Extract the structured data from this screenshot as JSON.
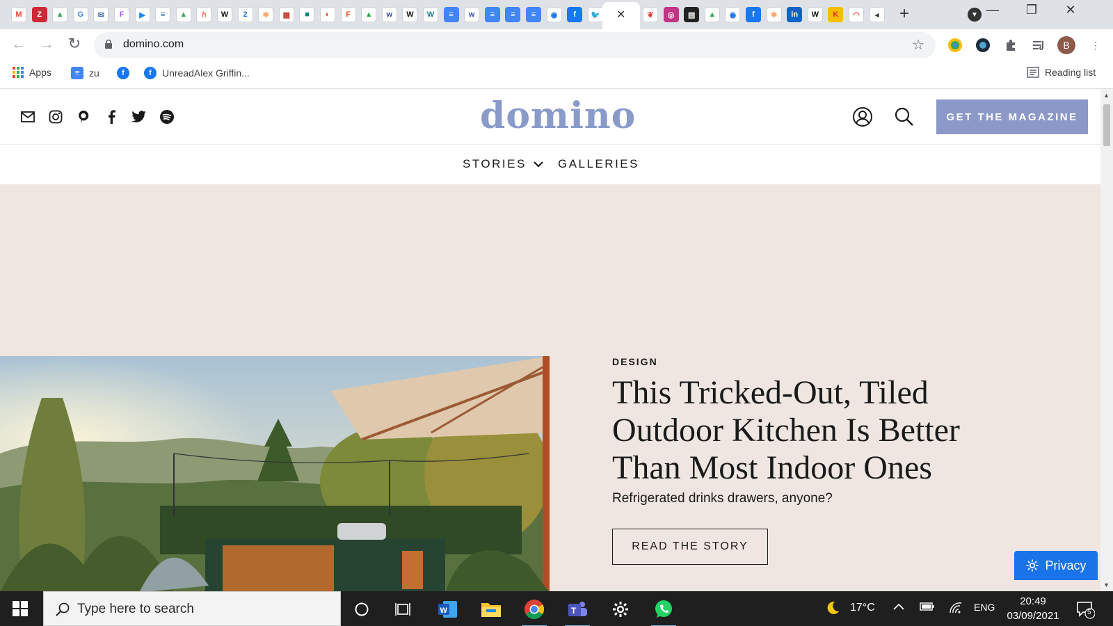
{
  "browser": {
    "tab_favicons": [
      {
        "name": "gmail",
        "bg": "#ffffff",
        "fg": "#ea4335",
        "glyph": "M"
      },
      {
        "name": "zotero",
        "bg": "#cc2936",
        "fg": "#ffffff",
        "glyph": "Z"
      },
      {
        "name": "drive",
        "bg": "#ffffff",
        "fg": "#34a853",
        "glyph": "▲"
      },
      {
        "name": "google",
        "bg": "#ffffff",
        "fg": "#4285f4",
        "glyph": "G"
      },
      {
        "name": "mail",
        "bg": "#ffffff",
        "fg": "#4a6fa5",
        "glyph": "✉"
      },
      {
        "name": "figma",
        "bg": "#ffffff",
        "fg": "#a259ff",
        "glyph": "F"
      },
      {
        "name": "video",
        "bg": "#ffffff",
        "fg": "#1e88e5",
        "glyph": "▶"
      },
      {
        "name": "stack",
        "bg": "#ffffff",
        "fg": "#1565c0",
        "glyph": "≡"
      },
      {
        "name": "drive",
        "bg": "#ffffff",
        "fg": "#34a853",
        "glyph": "▲"
      },
      {
        "name": "hubspot",
        "bg": "#ffffff",
        "fg": "#ff7a59",
        "glyph": "ℎ"
      },
      {
        "name": "wix",
        "bg": "#ffffff",
        "fg": "#111111",
        "glyph": "W"
      },
      {
        "name": "calendar",
        "bg": "#ffffff",
        "fg": "#1a73e8",
        "glyph": "2"
      },
      {
        "name": "asterisk",
        "bg": "#ffffff",
        "fg": "#f6a96c",
        "glyph": "✱"
      },
      {
        "name": "planner",
        "bg": "#ffffff",
        "fg": "#c0392b",
        "glyph": "▦"
      },
      {
        "name": "meet",
        "bg": "#ffffff",
        "fg": "#00897b",
        "glyph": "■"
      },
      {
        "name": "chat",
        "bg": "#ffffff",
        "fg": "#ea4335",
        "glyph": "◐"
      },
      {
        "name": "figma",
        "bg": "#ffffff",
        "fg": "#f24e1e",
        "glyph": "F"
      },
      {
        "name": "drive",
        "bg": "#ffffff",
        "fg": "#34a853",
        "glyph": "▲"
      },
      {
        "name": "wave",
        "bg": "#ffffff",
        "fg": "#3949ab",
        "glyph": "w"
      },
      {
        "name": "wix",
        "bg": "#ffffff",
        "fg": "#111111",
        "glyph": "W"
      },
      {
        "name": "wordpress",
        "bg": "#ffffff",
        "fg": "#21759b",
        "glyph": "W"
      },
      {
        "name": "docs",
        "bg": "#4285f4",
        "fg": "#ffffff",
        "glyph": "≡"
      },
      {
        "name": "wave",
        "bg": "#ffffff",
        "fg": "#3949ab",
        "glyph": "w"
      },
      {
        "name": "docs",
        "bg": "#4285f4",
        "fg": "#ffffff",
        "glyph": "≡"
      },
      {
        "name": "docs",
        "bg": "#4285f4",
        "fg": "#ffffff",
        "glyph": "≡"
      },
      {
        "name": "docs",
        "bg": "#4285f4",
        "fg": "#ffffff",
        "glyph": "≡"
      },
      {
        "name": "circle",
        "bg": "#ffffff",
        "fg": "#1a73e8",
        "glyph": "◉"
      },
      {
        "name": "facebook",
        "bg": "#1877f2",
        "fg": "#ffffff",
        "glyph": "f"
      },
      {
        "name": "twitter",
        "bg": "#ffffff",
        "fg": "#1da1f2",
        "glyph": "🐦"
      }
    ],
    "tab_favicons_right": [
      {
        "name": "bow",
        "bg": "#ffffff",
        "fg": "#e53935",
        "glyph": "❦"
      },
      {
        "name": "instagram",
        "bg": "#c13584",
        "fg": "#ffffff",
        "glyph": "◎"
      },
      {
        "name": "film",
        "bg": "#222222",
        "fg": "#ffffff",
        "glyph": "▤"
      },
      {
        "name": "drive",
        "bg": "#ffffff",
        "fg": "#34a853",
        "glyph": "▲"
      },
      {
        "name": "circle",
        "bg": "#ffffff",
        "fg": "#1a73e8",
        "glyph": "◉"
      },
      {
        "name": "facebook",
        "bg": "#1877f2",
        "fg": "#ffffff",
        "glyph": "f"
      },
      {
        "name": "asterisk",
        "bg": "#ffffff",
        "fg": "#f6a96c",
        "glyph": "✱"
      },
      {
        "name": "linkedin",
        "bg": "#0a66c2",
        "fg": "#ffffff",
        "glyph": "in"
      },
      {
        "name": "wikipedia",
        "bg": "#ffffff",
        "fg": "#111111",
        "glyph": "W"
      },
      {
        "name": "keep",
        "bg": "#fbbc04",
        "fg": "#d93025",
        "glyph": "K"
      },
      {
        "name": "rainbow",
        "bg": "#ffffff",
        "fg": "#e53935",
        "glyph": "◠"
      },
      {
        "name": "audio",
        "bg": "#ffffff",
        "fg": "#333333",
        "glyph": "◂"
      }
    ],
    "url": "domino.com",
    "bookmarks": {
      "apps": "Apps",
      "zu": "zu",
      "unread": "UnreadAlex Griffin...",
      "reading_list": "Reading list"
    },
    "profile_initial": "B"
  },
  "site": {
    "logo": "domino",
    "cta_magazine": "GET THE MAGAZINE",
    "nav": {
      "stories": "STORIES",
      "galleries": "GALLERIES"
    },
    "hero": {
      "kicker": "DESIGN",
      "headline": "This Tricked-Out, Tiled Outdoor Kitchen Is Better Than Most Indoor Ones",
      "dek": "Refrigerated drinks drawers, anyone?",
      "cta": "READ THE STORY"
    },
    "privacy": "Privacy",
    "colors": {
      "brand": "#8b98c8",
      "page_bg": "#efe6e1"
    }
  },
  "taskbar": {
    "search_placeholder": "Type here to search",
    "temperature": "17°C",
    "language": "ENG",
    "time": "20:49",
    "date": "03/09/2021",
    "notification_count": "5"
  }
}
